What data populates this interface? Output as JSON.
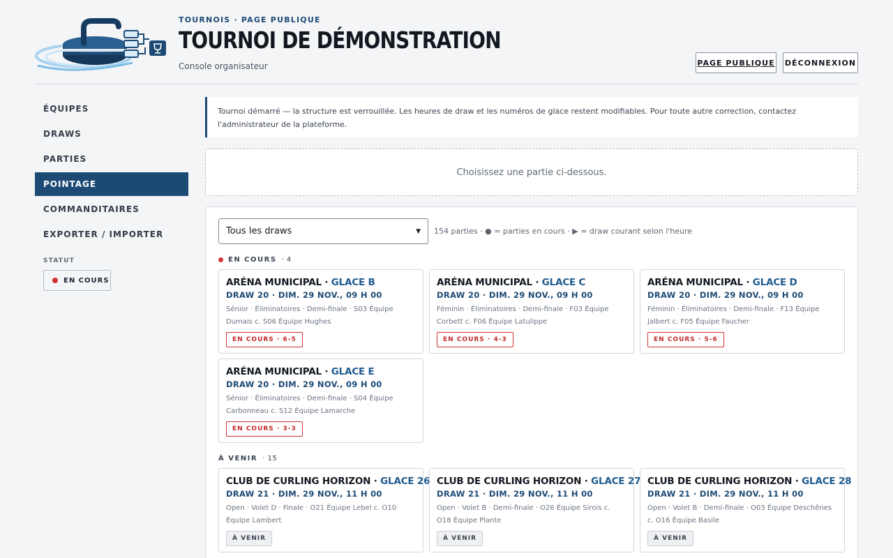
{
  "header": {
    "breadcrumb": "TOURNOIS · PAGE PUBLIQUE",
    "title": "TOURNOI DE DÉMONSTRATION",
    "subtitle": "Console organisateur",
    "public_button": "PAGE PUBLIQUE",
    "logout_button": "DÉCONNEXION"
  },
  "sidebar": {
    "items": [
      {
        "label": "ÉQUIPES"
      },
      {
        "label": "DRAWS"
      },
      {
        "label": "PARTIES"
      },
      {
        "label": "POINTAGE",
        "active": true
      },
      {
        "label": "COMMANDITAIRES"
      },
      {
        "label": "EXPORTER / IMPORTER"
      }
    ],
    "status_label": "STATUT",
    "status_value": "EN COURS"
  },
  "notice": "Tournoi démarré — la structure est verrouillée. Les heures de draw et les numéros de glace restent modifiables. Pour toute autre correction, contactez l'administrateur de la plateforme.",
  "placeholder": "Choisissez une partie ci-dessous.",
  "filter": {
    "selected": "Tous les draws",
    "legend": "154 parties · ● = parties en cours · ▶ = draw courant selon l'heure"
  },
  "sections": {
    "live": {
      "label": "EN COURS",
      "count": "· 4"
    },
    "upcoming": {
      "label": "À VENIR",
      "count": "· 15"
    }
  },
  "live_games": [
    {
      "venue": "ARÉNA MUNICIPAL · ",
      "ice": "GLACE B",
      "draw": "DRAW 20 · DIM. 29 NOV., 09 H 00",
      "desc": "Sénior · Éliminatoires · Demi-finale · S03 Équipe Dumais c. S06 Équipe Hughes",
      "badge": "EN COURS · 6-5"
    },
    {
      "venue": "ARÉNA MUNICIPAL · ",
      "ice": "GLACE C",
      "draw": "DRAW 20 · DIM. 29 NOV., 09 H 00",
      "desc": "Féminin · Éliminatoires · Demi-finale · F03 Équipe Corbett c. F06 Équipe Latulippe",
      "badge": "EN COURS · 4-3"
    },
    {
      "venue": "ARÉNA MUNICIPAL · ",
      "ice": "GLACE D",
      "draw": "DRAW 20 · DIM. 29 NOV., 09 H 00",
      "desc": "Féminin · Éliminatoires · Demi-finale · F13 Équipe Jalbert c. F05 Équipe Faucher",
      "badge": "EN COURS · 5-6"
    },
    {
      "venue": "ARÉNA MUNICIPAL · ",
      "ice": "GLACE E",
      "draw": "DRAW 20 · DIM. 29 NOV., 09 H 00",
      "desc": "Sénior · Éliminatoires · Demi-finale · S04 Équipe Carbonneau c. S12 Équipe Lamarche",
      "badge": "EN COURS · 3-3"
    }
  ],
  "upcoming_games": [
    {
      "venue": "CLUB DE CURLING HORIZON · ",
      "ice": "GLACE 26",
      "draw": "DRAW 21 · DIM. 29 NOV., 11 H 00",
      "desc": "Open · Volet D · Finale · O21 Équipe Lebel c. O10 Équipe Lambert",
      "badge": "À VENIR"
    },
    {
      "venue": "CLUB DE CURLING HORIZON · ",
      "ice": "GLACE 27",
      "draw": "DRAW 21 · DIM. 29 NOV., 11 H 00",
      "desc": "Open · Volet B · Demi-finale · O26 Équipe Sirois c. O18 Équipe Plante",
      "badge": "À VENIR"
    },
    {
      "venue": "CLUB DE CURLING HORIZON · ",
      "ice": "GLACE 28",
      "draw": "DRAW 21 · DIM. 29 NOV., 11 H 00",
      "desc": "Open · Volet B · Demi-finale · O03 Équipe Deschênes c. O16 Équipe Basile",
      "badge": "À VENIR"
    }
  ],
  "colors": {
    "accent": "#1d4a74",
    "live": "#d33131",
    "background": "#f4f5f7"
  }
}
